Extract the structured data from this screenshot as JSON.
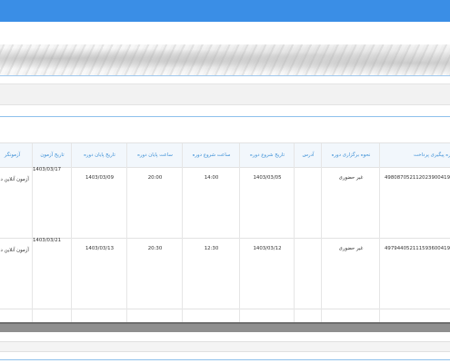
{
  "table": {
    "headers": {
      "examiner": "آزمونگر",
      "exam_date": "تاریخ آزمون",
      "end_date": "تاریخ پایان دوره",
      "end_time": "ساعت پایان دوره",
      "start_time": "ساعت شروع دوره",
      "start_date": "تاریخ شروع دوره",
      "address": "آدرس",
      "method": "نحوه برگزاری دوره",
      "tracking": "شماره پیگیری پرداخت"
    },
    "rows": [
      {
        "examiner": "آزمون آنلاین دان",
        "exam_date": "1403/03/17",
        "end_date": "1403/03/09",
        "end_time": "20:00",
        "start_time": "14:00",
        "start_date": "1403/03/05",
        "address": "",
        "method": "غیر حضوری",
        "tracking": "4980870521120239004191811"
      },
      {
        "examiner": "آزمون آنلاین دان",
        "exam_date": "1403/03/21",
        "end_date": "1403/03/13",
        "end_time": "20:30",
        "start_time": "12:30",
        "start_date": "1403/03/12",
        "address": "",
        "method": "غیر حضوری",
        "tracking": "4979440521115936004191811"
      }
    ]
  }
}
